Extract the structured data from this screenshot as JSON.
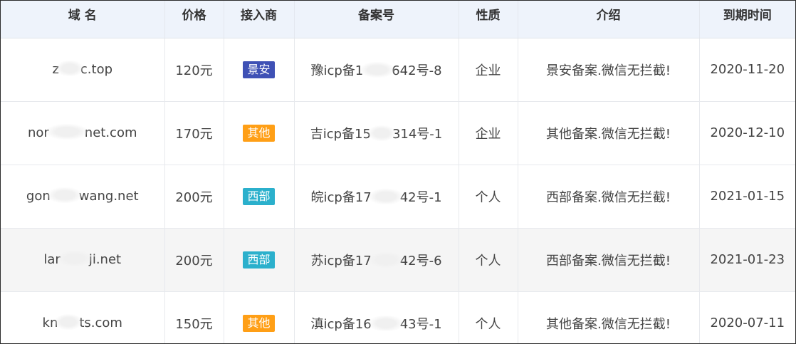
{
  "colors": {
    "header_bg": "#eef3fb",
    "jingan": "#3f51b5",
    "qita": "#ff9f16",
    "xibu": "#2bb0cc"
  },
  "headers": [
    "域 名",
    "价格",
    "接入商",
    "备案号",
    "性质",
    "介绍",
    "到期时间"
  ],
  "rows": [
    {
      "domain": "z▒▒▒c.top",
      "price": "120元",
      "provider": "景安",
      "provider_color": "#3f51b5",
      "icp": "豫icp备1▒▒▒▒642号-8",
      "type": "企业",
      "intro": "景安备案.微信无拦截!",
      "expiry": "2020-11-20"
    },
    {
      "domain": "nor▒▒▒▒▒net.com",
      "price": "170元",
      "provider": "其他",
      "provider_color": "#ff9f16",
      "icp": "吉icp备15▒▒▒314号-1",
      "type": "企业",
      "intro": "其他备案.微信无拦截!",
      "expiry": "2020-12-10"
    },
    {
      "domain": "gon▒▒▒▒wang.net",
      "price": "200元",
      "provider": "西部",
      "provider_color": "#2bb0cc",
      "icp": "皖icp备17▒▒▒▒42号-1",
      "type": "个人",
      "intro": "西部备案.微信无拦截!",
      "expiry": "2021-01-15"
    },
    {
      "domain": "lar▒▒▒▒ji.net",
      "price": "200元",
      "provider": "西部",
      "provider_color": "#2bb0cc",
      "icp": "苏icp备17▒▒▒▒42号-6",
      "type": "个人",
      "intro": "西部备案.微信无拦截!",
      "expiry": "2021-01-23"
    },
    {
      "domain": "kn▒▒▒ts.com",
      "price": "150元",
      "provider": "其他",
      "provider_color": "#ff9f16",
      "icp": "滇icp备16▒▒▒▒43号-1",
      "type": "个人",
      "intro": "其他备案.微信无拦截!",
      "expiry": "2020-07-11"
    }
  ]
}
